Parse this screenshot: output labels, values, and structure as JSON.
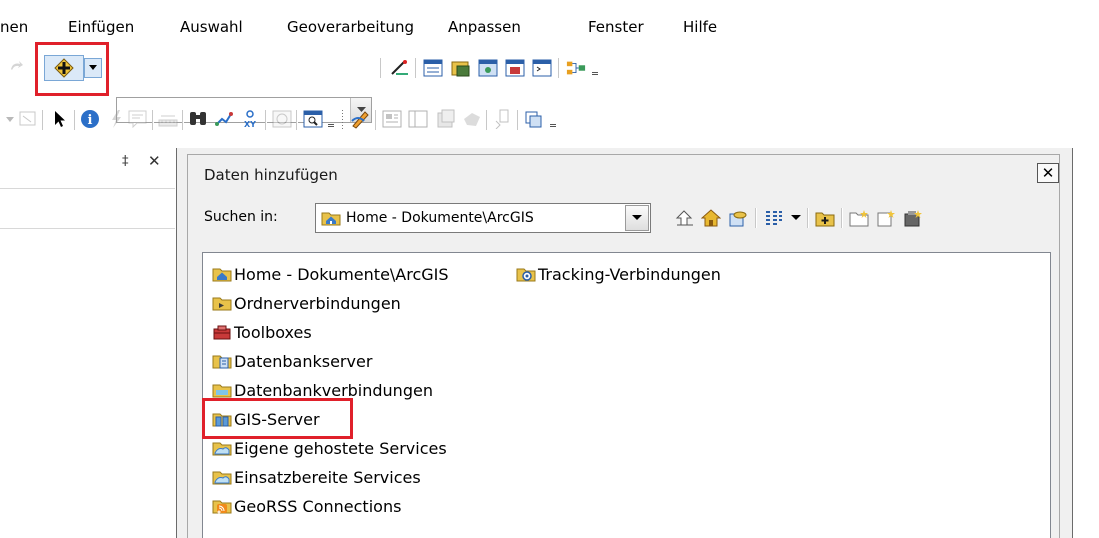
{
  "menubar": {
    "items": [
      {
        "label": "nen"
      },
      {
        "label": "Einfügen"
      },
      {
        "label": "Auswahl"
      },
      {
        "label": "Geoverarbeitung"
      },
      {
        "label": "Anpassen"
      },
      {
        "label": "Fenster"
      },
      {
        "label": "Hilfe"
      }
    ]
  },
  "toolbar": {
    "scale_combo_value": "",
    "add_data_icon": "add-data-icon"
  },
  "left_panel": {
    "pin_glyph": "‡",
    "close_glyph": "✕"
  },
  "dialog": {
    "title": "Daten hinzufügen",
    "close_glyph": "✕",
    "search_label": "Suchen in:",
    "location_value": "Home - Dokumente\\ArcGIS",
    "items": [
      {
        "label": "Home - Dokumente\\ArcGIS",
        "icon": "home-folder-icon"
      },
      {
        "label": "Tracking-Verbindungen",
        "icon": "tracking-connection-icon"
      },
      {
        "label": "Ordnerverbindungen",
        "icon": "folder-connections-icon"
      },
      {
        "label": "Toolboxes",
        "icon": "toolbox-icon"
      },
      {
        "label": "Datenbankserver",
        "icon": "database-server-icon"
      },
      {
        "label": "Datenbankverbindungen",
        "icon": "database-connections-icon"
      },
      {
        "label": "GIS-Server",
        "icon": "gis-server-icon"
      },
      {
        "label": "Eigene gehostete Services",
        "icon": "hosted-services-icon"
      },
      {
        "label": "Einsatzbereite Services",
        "icon": "ready-services-icon"
      },
      {
        "label": "GeoRSS Connections",
        "icon": "georss-icon"
      }
    ]
  },
  "colors": {
    "highlight": "#e0202a",
    "folder": "#e8c24a",
    "dialog_bg": "#f0f0f0"
  }
}
